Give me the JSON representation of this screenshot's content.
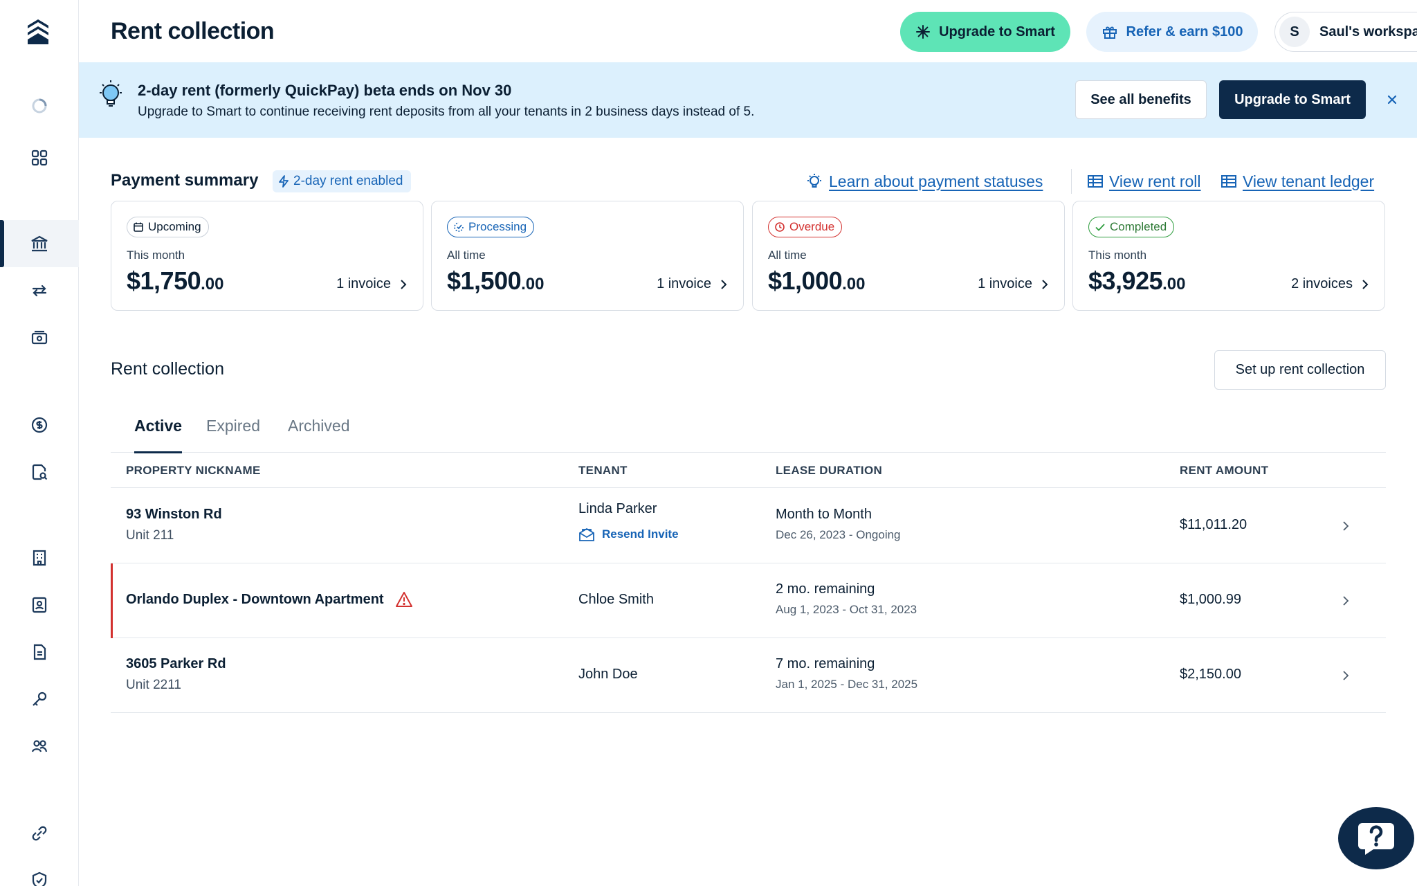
{
  "header": {
    "title": "Rent collection",
    "upgrade_label": "Upgrade to Smart",
    "refer_label": "Refer & earn $100",
    "workspace_initial": "S",
    "workspace_name": "Saul's workspace"
  },
  "sidebar": {
    "items": [
      {
        "icon": "loading-spinner-icon"
      },
      {
        "icon": "dashboard-grid-icon"
      },
      {
        "icon": "bank-icon",
        "active": true
      },
      {
        "icon": "transfer-arrows-icon"
      },
      {
        "icon": "cash-icon"
      },
      {
        "icon": "dollar-circle-icon"
      },
      {
        "icon": "document-search-icon"
      },
      {
        "icon": "building-icon"
      },
      {
        "icon": "tenant-card-icon"
      },
      {
        "icon": "lease-document-icon"
      },
      {
        "icon": "key-icon"
      },
      {
        "icon": "people-icon"
      },
      {
        "icon": "settings-link-icon"
      },
      {
        "icon": "shield-check-icon"
      }
    ]
  },
  "banner": {
    "title": "2-day rent (formerly QuickPay) beta ends on Nov 30",
    "subtitle": "Upgrade to Smart to continue receiving rent deposits from all your tenants in 2 business days instead of 5.",
    "benefits_label": "See all benefits",
    "upgrade_label": "Upgrade to Smart"
  },
  "payment_summary": {
    "title": "Payment summary",
    "badge": "2-day rent enabled",
    "learn_link": "Learn about payment statuses",
    "rent_roll_link": "View rent roll",
    "tenant_ledger_link": "View tenant ledger",
    "cards": [
      {
        "status": "Upcoming",
        "period": "This month",
        "amount": "$1,750",
        "cents": ".00",
        "invoices": "1 invoice"
      },
      {
        "status": "Processing",
        "period": "All time",
        "amount": "$1,500",
        "cents": ".00",
        "invoices": "1 invoice"
      },
      {
        "status": "Overdue",
        "period": "All time",
        "amount": "$1,000",
        "cents": ".00",
        "invoices": "1 invoice"
      },
      {
        "status": "Completed",
        "period": "This month",
        "amount": "$3,925",
        "cents": ".00",
        "invoices": "2 invoices"
      }
    ]
  },
  "rent_collection": {
    "title": "Rent collection",
    "setup_label": "Set up rent collection",
    "tabs": [
      "Active",
      "Expired",
      "Archived"
    ],
    "columns": [
      "PROPERTY NICKNAME",
      "TENANT",
      "LEASE DURATION",
      "RENT AMOUNT"
    ],
    "rows": [
      {
        "property": "93 Winston Rd",
        "unit": "Unit 211",
        "tenant": "Linda Parker",
        "action": "Resend Invite",
        "duration": "Month to Month",
        "dates": "Dec 26, 2023 - Ongoing",
        "rent": "$11,011.20"
      },
      {
        "property": "Orlando Duplex - Downtown Apartment",
        "unit": "",
        "tenant": "Chloe Smith",
        "action": "",
        "duration": "2 mo. remaining",
        "dates": "Aug 1, 2023 - Oct 31, 2023",
        "rent": "$1,000.99"
      },
      {
        "property": "3605 Parker Rd",
        "unit": "Unit 2211",
        "tenant": "John Doe",
        "action": "",
        "duration": "7 mo. remaining",
        "dates": "Jan 1, 2025 - Dec 31, 2025",
        "rent": "$2,150.00"
      }
    ]
  },
  "colors": {
    "brand_navy": "#0d2a4a",
    "accent_mint": "#5ee4b6",
    "link_blue": "#1764b6",
    "banner_bg": "#dcf0fd",
    "alert_red": "#d3312f",
    "success_green": "#2e9d3e"
  }
}
